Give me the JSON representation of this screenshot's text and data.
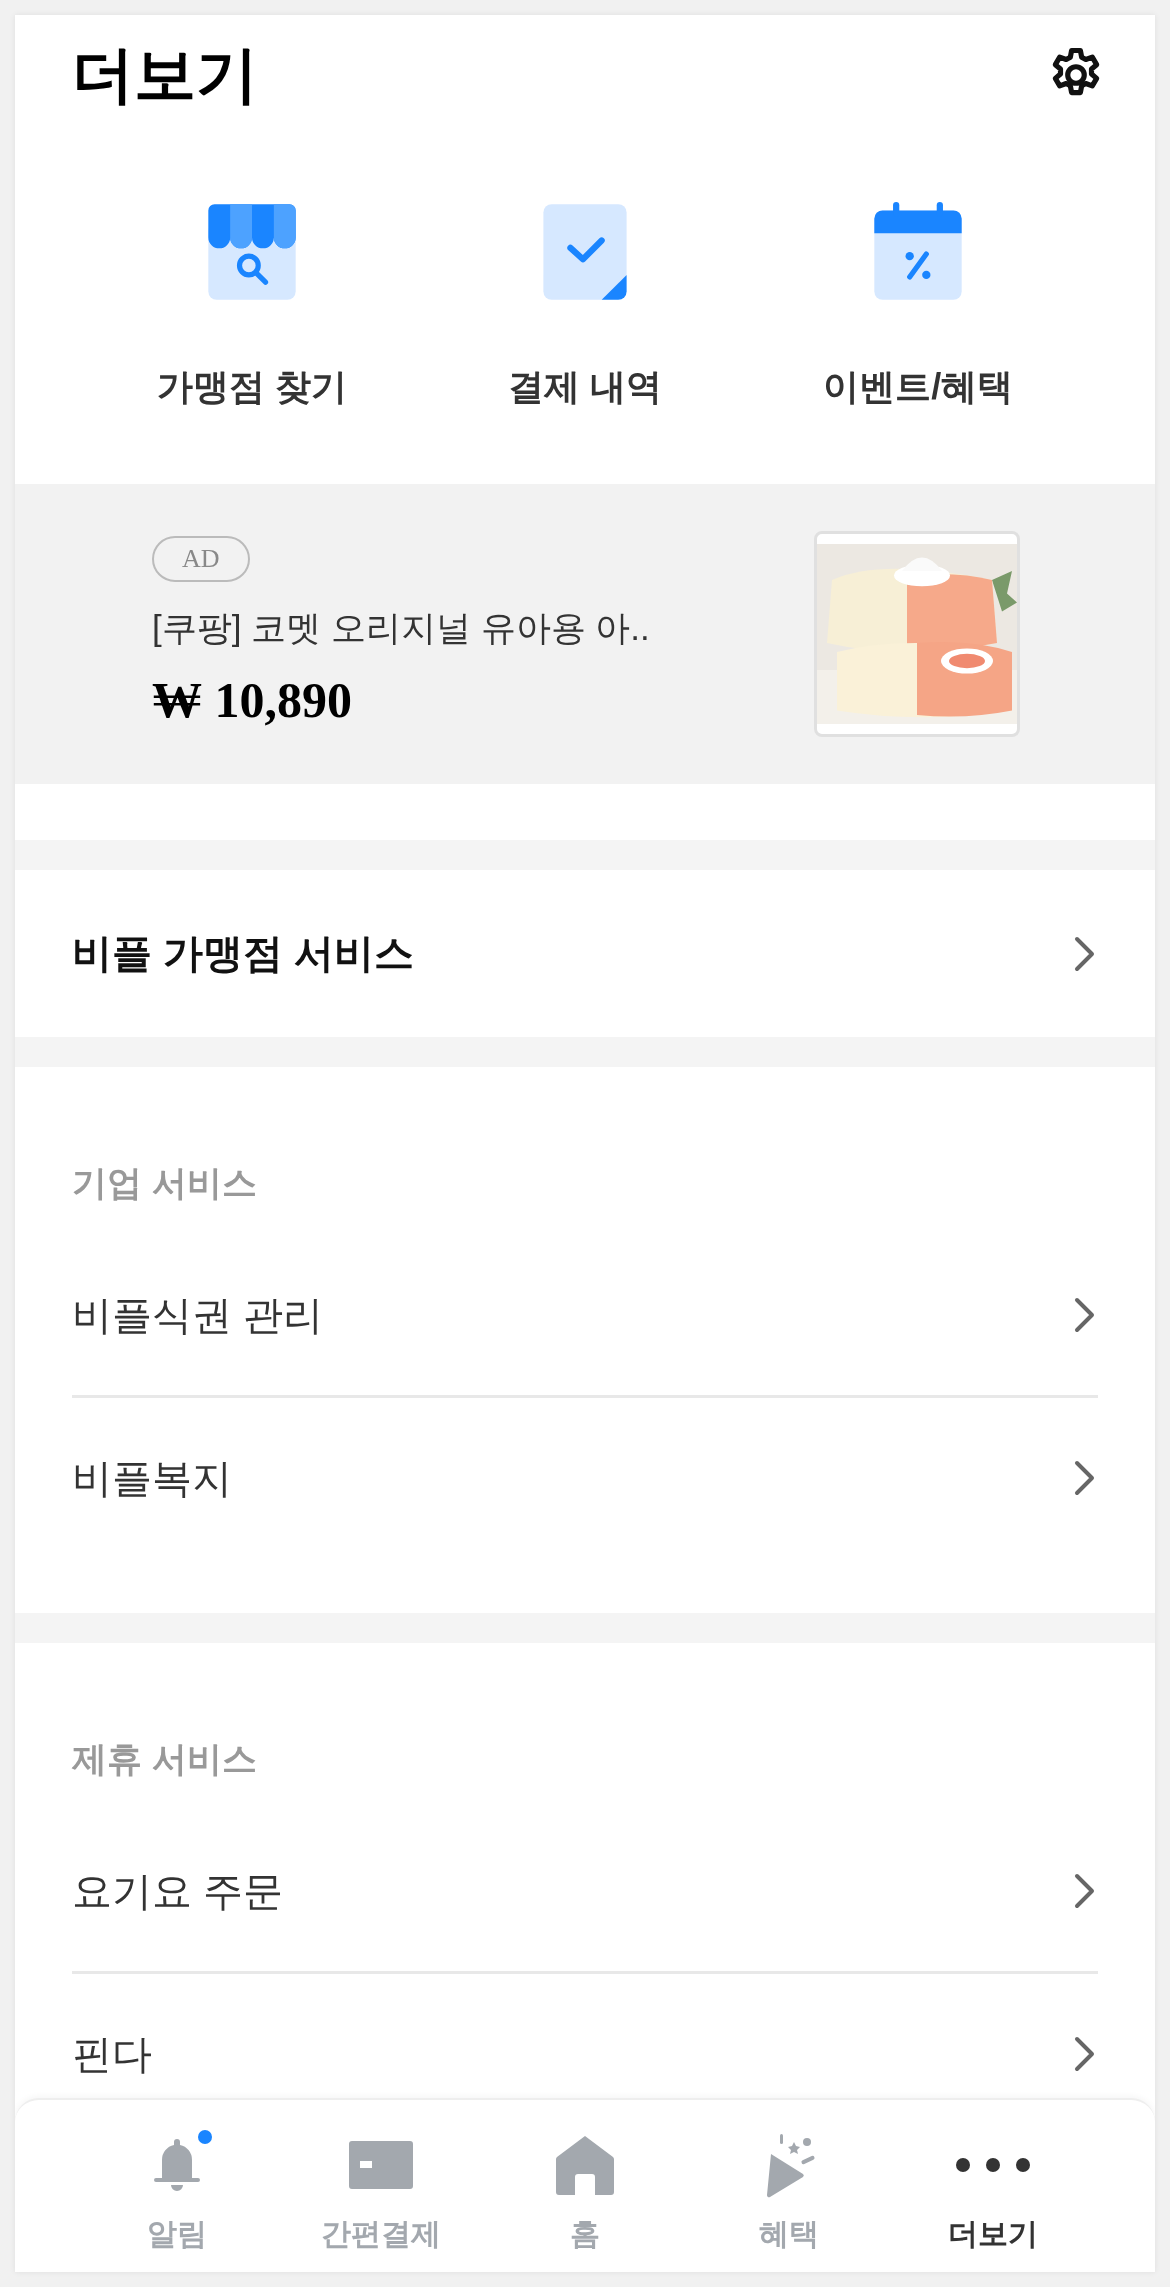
{
  "header": {
    "title": "더보기"
  },
  "shortcuts": [
    {
      "label": "가맹점 찾기",
      "kind": "store"
    },
    {
      "label": "결제 내역",
      "kind": "receipt"
    },
    {
      "label": "이벤트/혜택",
      "kind": "calendar"
    }
  ],
  "ad": {
    "badge": "AD",
    "title": "[쿠팡] 코멧 오리지널 유아용 아..",
    "price": "₩ 10,890"
  },
  "featured": {
    "label": "비플 가맹점 서비스"
  },
  "sections": [
    {
      "title": "기업 서비스",
      "items": [
        {
          "label": "비플식권 관리"
        },
        {
          "label": "비플복지"
        }
      ]
    },
    {
      "title": "제휴 서비스",
      "items": [
        {
          "label": "요기요 주문"
        },
        {
          "label": "핀다"
        }
      ]
    }
  ],
  "bottom_nav": [
    {
      "label": "알림",
      "kind": "bell",
      "selected": false,
      "notification": true
    },
    {
      "label": "간편결제",
      "kind": "card",
      "selected": false,
      "notification": false
    },
    {
      "label": "홈",
      "kind": "home",
      "selected": false,
      "notification": false
    },
    {
      "label": "혜택",
      "kind": "party",
      "selected": false,
      "notification": false
    },
    {
      "label": "더보기",
      "kind": "more",
      "selected": true,
      "notification": false
    }
  ]
}
